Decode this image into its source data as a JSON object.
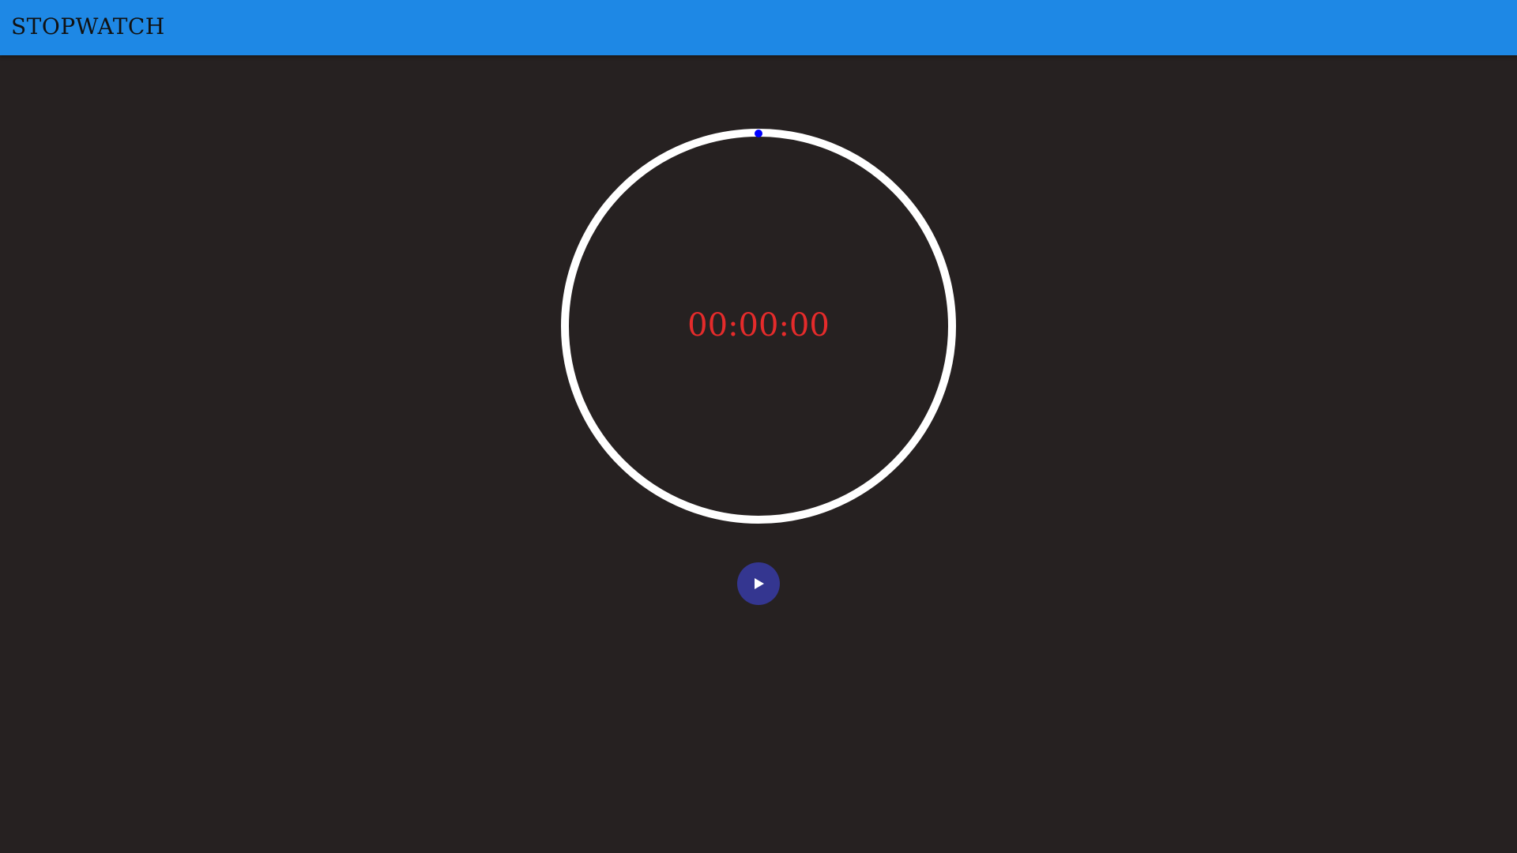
{
  "app": {
    "title": "STOPWATCH"
  },
  "timer": {
    "display": "00:00:00",
    "elapsed_fraction": 0
  },
  "controls": {
    "play_icon": "play-icon"
  },
  "colors": {
    "app_bar": "#1e88e5",
    "background": "#262121",
    "dial_ring": "#ffffff",
    "progress_marker": "#0000ff",
    "time_text": "#e52b2b",
    "play_button": "#343690"
  }
}
